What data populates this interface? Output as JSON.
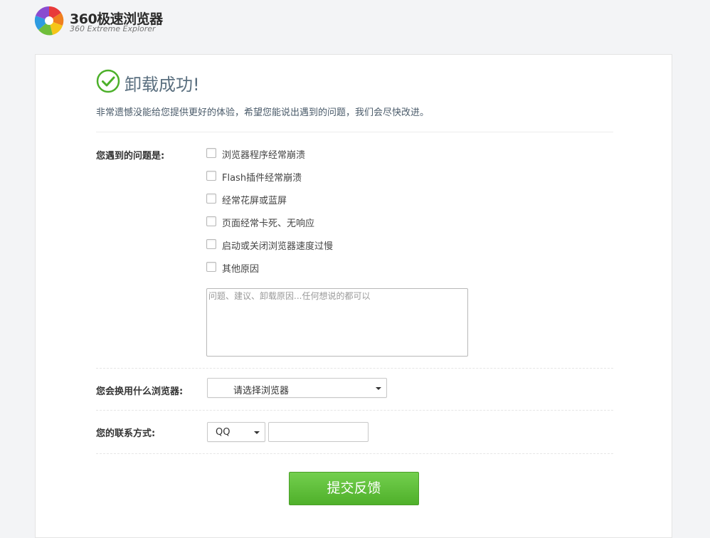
{
  "brand": {
    "title": "360极速浏览器",
    "subtitle": "360 Extreme Explorer"
  },
  "header": {
    "title": "卸载成功!",
    "message": "非常遗憾没能给您提供更好的体验，希望您能说出遇到的问题，我们会尽快改进。"
  },
  "problems": {
    "label": "您遇到的问题是:",
    "options": [
      {
        "label": "浏览器程序经常崩溃",
        "checked": false
      },
      {
        "label": "Flash插件经常崩溃",
        "checked": false
      },
      {
        "label": "经常花屏或蓝屏",
        "checked": false
      },
      {
        "label": "页面经常卡死、无响应",
        "checked": false
      },
      {
        "label": "启动或关闭浏览器速度过慢",
        "checked": false
      },
      {
        "label": "其他原因",
        "checked": false
      }
    ],
    "textarea_placeholder": "问题、建议、卸载原因...任何想说的都可以",
    "textarea_value": ""
  },
  "browser_choice": {
    "label": "您会换用什么浏览器:",
    "selected": "请选择浏览器"
  },
  "contact": {
    "label": "您的联系方式:",
    "type_selected": "QQ",
    "value": ""
  },
  "submit": {
    "label": "提交反馈"
  },
  "colors": {
    "page_background": "#f3f4f6",
    "success_green": "#4cb02a",
    "submit_green": "#5cbd35",
    "heading_gray": "#5a6f7f"
  },
  "icons": {
    "logo": "360-browser-pinwheel-logo",
    "success": "check-circle-icon",
    "dropdown": "caret-down-icon"
  }
}
